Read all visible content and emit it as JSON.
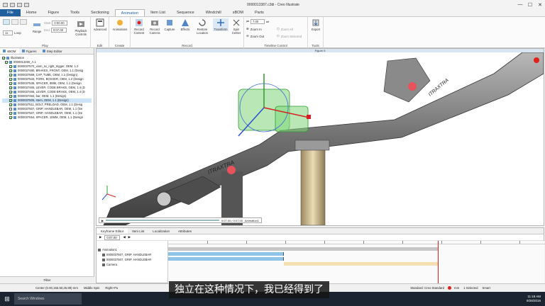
{
  "window": {
    "title": "0000013387.c3di - Creo Illustrate",
    "minimize": "—",
    "maximize": "☐",
    "close": "✕"
  },
  "tabs": [
    {
      "label": "File"
    },
    {
      "label": "Home"
    },
    {
      "label": "Figure"
    },
    {
      "label": "Tools"
    },
    {
      "label": "Sectioning"
    },
    {
      "label": "Animation"
    },
    {
      "label": "Item List"
    },
    {
      "label": "Sequence"
    },
    {
      "label": "Windchill"
    },
    {
      "label": "sBOM"
    },
    {
      "label": "Parts"
    }
  ],
  "ribbon": {
    "play": {
      "group": "Play",
      "start_label": "Start",
      "end_label": "End",
      "start_value": "0:00.00",
      "end_value": "0:07.00",
      "speed": "1x",
      "loop": "Loop",
      "range": "Range",
      "playback": "Playback Controls"
    },
    "edit": {
      "group": "Edit",
      "advanced": "Advanced"
    },
    "create": {
      "group": "Create",
      "animations": "Animations"
    },
    "record": {
      "group": "Record",
      "record_content": "Record Content",
      "record_camera": "Record Camera",
      "capture": "Capture",
      "effects": "Effects",
      "restore_location": "Restore Location",
      "transform": "Transform",
      "spin_center": "Spin Center"
    },
    "timeline": {
      "group": "Timeline Control",
      "time_value": "7.00",
      "zoom_in": "Zoom In",
      "zoom_out": "Zoom Out",
      "zoom_all": "Zoom All",
      "zoom_selected": "Zoom Selected"
    },
    "tools": {
      "group": "Tools",
      "export": "Export"
    }
  },
  "left_panel": {
    "tabs": [
      "sBOM",
      "Figures",
      "Step Editor"
    ],
    "items": [
      {
        "label": "Illustration",
        "checked": true,
        "selected": false
      },
      {
        "label": "0000013260_A.1",
        "checked": true,
        "selected": false
      },
      {
        "label": "0000037570_xiom_sx_right_trigger, OEM, 1.2",
        "checked": true,
        "selected": false
      },
      {
        "label": "0000037480, BRAKES, FRONT, OEM, 1.1 (Desig",
        "checked": true,
        "selected": false
      },
      {
        "label": "0000037669, CAP, TUBE, OEM, 1.1 (Design)",
        "checked": true,
        "selected": false
      },
      {
        "label": "0000037533, FORK, BOXXER, OEM, 1.2 (Design",
        "checked": true,
        "selected": false
      },
      {
        "label": "0000037536, SPACER, 8MM, OEM, 1.1 (Design",
        "checked": true,
        "selected": false
      },
      {
        "label": "0000037465, LEVER, CODE BRAKE, OEM, 1.4 (D",
        "checked": true,
        "selected": false
      },
      {
        "label": "0000037466, LEVER, CODE BRAKE, OEM, 1.4 (D",
        "checked": true,
        "selected": false
      },
      {
        "label": "0000037484, bar, OEM, 1.1 (Design)",
        "checked": true,
        "selected": false
      },
      {
        "label": "0000037505, stem, OEM, 1.1 (Design)",
        "checked": true,
        "selected": true
      },
      {
        "label": "0000037511, BOLT, PRELOAD, OEM, 1.1 (Desig",
        "checked": true,
        "selected": false
      },
      {
        "label": "0000037507, GRIP, HANDLEBAR, OEM, 1.1 (De",
        "checked": false,
        "selected": false
      },
      {
        "label": "0000037507, GRIP, HANDLEBAR, OEM, 1.1 (De",
        "checked": true,
        "selected": false
      },
      {
        "label": "0000037554, SPACER, 10MM, OEM, 1.1 (Design",
        "checked": true,
        "selected": false
      }
    ],
    "filter": "Filter"
  },
  "viewport": {
    "title": "Figure 9",
    "playbar_time": "0:07.00 / 0:07.00",
    "playbar_anim": "Animation1"
  },
  "bottom_panel": {
    "tabs": [
      "Keyframe Editor",
      "Item List",
      "Localization",
      "Attributes"
    ],
    "time": "0:07.00",
    "tracks": [
      "Animation1",
      "0000037507, GRIP, HANDLEBAR",
      "0000037507, GRIP, HANDLEBAR",
      "Camera"
    ]
  },
  "statusbar": {
    "center": "Center (0.00,155.50,26.89) mm",
    "spin": "Middle Spin",
    "pan": "Right+Pu",
    "standard": "Standard: Creo Standard",
    "units": "mm",
    "selected": "1 Selected",
    "mode": "Smart"
  },
  "taskbar": {
    "search": "Search Windows",
    "time": "11:18 AM",
    "date": "9/28/2016"
  },
  "subtitle": "独立在这种情况下，我已经得到了",
  "colors": {
    "accent": "#1f5f9e",
    "record": "#e0201a",
    "selection_green": "#7fd67a"
  }
}
